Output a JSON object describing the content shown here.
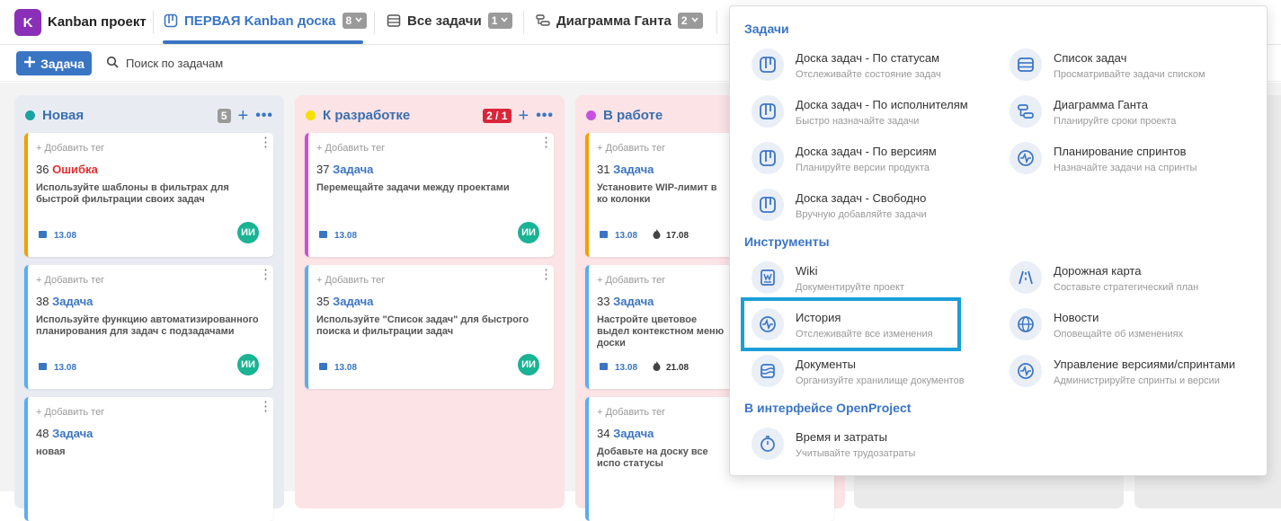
{
  "header": {
    "logo_letter": "K",
    "project_name": "Kanban проект",
    "tabs": [
      {
        "label": "ПЕРВАЯ Kanban доска",
        "count": "8",
        "active": true
      },
      {
        "label": "Все задачи",
        "count": "1"
      },
      {
        "label": "Диаграмма Ганта",
        "count": "2"
      }
    ]
  },
  "toolbar": {
    "add_label": "Задача",
    "search_placeholder": "Поиск по задачам"
  },
  "columns": [
    {
      "title": "Новая",
      "count": "5",
      "color": "#1aa3a3",
      "cards": [
        {
          "tag": "+ Добавить тег",
          "num": "36",
          "type": "Ошибка",
          "desc": "Используйте шаблоны в фильтрах для быстрой фильтрации своих задач",
          "date": "13.08",
          "est": "",
          "avatar": "ИИ"
        },
        {
          "tag": "+ Добавить тег",
          "num": "38",
          "type": "Задача",
          "desc": "Используйте функцию автоматизированного планирования для задач с подзадачами",
          "date": "13.08",
          "est": "",
          "avatar": "ИИ"
        },
        {
          "tag": "+ Добавить тег",
          "num": "48",
          "type": "Задача",
          "desc": "новая",
          "date": "",
          "est": "",
          "avatar": ""
        }
      ]
    },
    {
      "title": "К разработке",
      "count": "2 / 1",
      "color": "#f5e000",
      "cards": [
        {
          "tag": "+ Добавить тег",
          "num": "37",
          "type": "Задача",
          "desc": "Перемещайте задачи между проектами",
          "date": "13.08",
          "est": "",
          "avatar": "ИИ"
        },
        {
          "tag": "+ Добавить тег",
          "num": "35",
          "type": "Задача",
          "desc": "Используйте \"Список задач\" для быстрого поиска и фильтрации задач",
          "date": "13.08",
          "est": "",
          "avatar": "ИИ"
        }
      ]
    },
    {
      "title": "В работе",
      "count": "",
      "color": "#c94fe0",
      "cards": [
        {
          "tag": "+ Добавить тег",
          "num": "31",
          "type": "Задача",
          "desc": "Установите WIP-лимит в ко колонки",
          "date": "13.08",
          "est": "17.08",
          "avatar": ""
        },
        {
          "tag": "+ Добавить тег",
          "num": "33",
          "type": "Задача",
          "desc": "Настройте цветовое выдел контекстном меню доски",
          "date": "13.08",
          "est": "21.08",
          "avatar": ""
        },
        {
          "tag": "+ Добавить тег",
          "num": "34",
          "type": "Задача",
          "desc": "Добавьте на доску все испо статусы",
          "date": "",
          "est": "",
          "avatar": ""
        }
      ]
    }
  ],
  "menu": {
    "sections": [
      "Задачи",
      "Инструменты",
      "В интерфейсе OpenProject"
    ],
    "items": [
      {
        "title": "Доска задач - По статусам",
        "sub": "Отслеживайте состояние задач",
        "icon": "board-icon"
      },
      {
        "title": "Список задач",
        "sub": "Просматривайте задачи списком",
        "icon": "list-icon"
      },
      {
        "title": "Доска задач - По исполнителям",
        "sub": "Быстро назначайте задачи",
        "icon": "board-icon"
      },
      {
        "title": "Диаграмма Ганта",
        "sub": "Планируйте сроки проекта",
        "icon": "gantt-icon"
      },
      {
        "title": "Доска задач - По версиям",
        "sub": "Планируйте версии продукта",
        "icon": "board-icon"
      },
      {
        "title": "Планирование спринтов",
        "sub": "Назначайте задачи на спринты",
        "icon": "pulse-icon"
      },
      {
        "title": "Доска задач - Свободно",
        "sub": "Вручную добавляйте задачи",
        "icon": "board-icon"
      },
      {
        "title": "Wiki",
        "sub": "Документируйте проект",
        "icon": "wiki-icon"
      },
      {
        "title": "Дорожная карта",
        "sub": "Составьте стратегический план",
        "icon": "road-icon"
      },
      {
        "title": "История",
        "sub": "Отслеживайте все изменения",
        "icon": "pulse-icon"
      },
      {
        "title": "Новости",
        "sub": "Оповещайте об изменениях",
        "icon": "globe-icon"
      },
      {
        "title": "Документы",
        "sub": "Организуйте хранилище документов",
        "icon": "docs-icon"
      },
      {
        "title": "Управление версиями/спринтами",
        "sub": "Администрируйте спринты и версии",
        "icon": "pulse-icon"
      },
      {
        "title": "Время и затраты",
        "sub": "Учитывайте трудозатраты",
        "icon": "timer-icon"
      }
    ]
  },
  "colors": {
    "accent": "#3a75c4",
    "highlight": "#1a9fd6",
    "avatar": "#1ab394",
    "error": "#e03030"
  }
}
